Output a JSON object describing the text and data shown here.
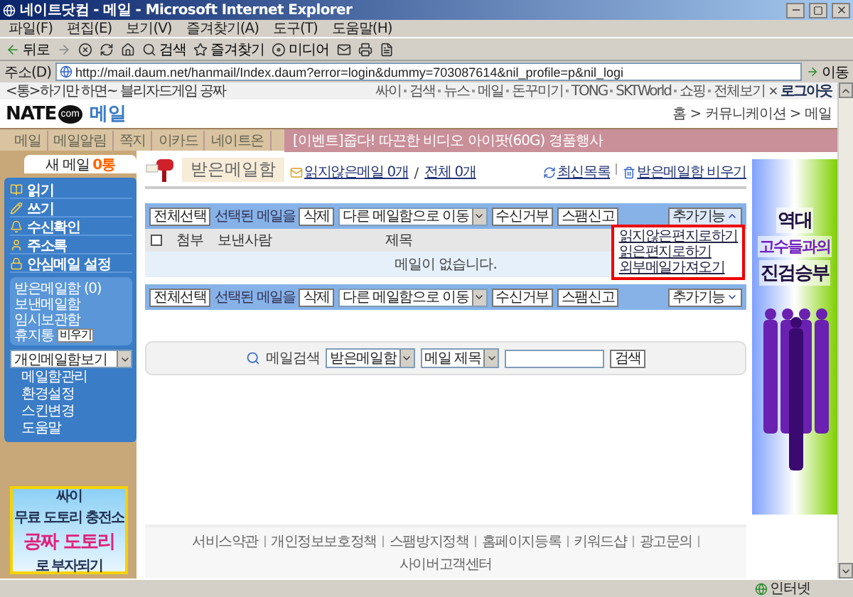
{
  "window": {
    "title": "네이트닷컴 - 메일 - Microsoft Internet Explorer"
  },
  "menu_bar": [
    "파일(F)",
    "편집(E)",
    "보기(V)",
    "즐겨찾기(A)",
    "도구(T)",
    "도움말(H)"
  ],
  "toolbar": {
    "back": "뒤로",
    "search": "검색",
    "favorites": "즐겨찾기",
    "media": "미디어"
  },
  "address_bar": {
    "label": "주소(D)",
    "url": "http://mail.daum.net/hanmail/Index.daum?error=login&dummy=703087614&nil_profile=p&nil_logi",
    "go": "이동"
  },
  "top_strip": {
    "promo": "<통>하기만 하면~ 블리자드게임 공짜",
    "links": [
      "싸이",
      "검색",
      "뉴스",
      "메일",
      "돈꾸미기",
      "TONG",
      "SKTWorld",
      "쇼핑",
      "전체보기"
    ],
    "logout": "로그아웃"
  },
  "header": {
    "logo": "NATE",
    "logo_badge": "com",
    "service": "메일",
    "breadcrumb": "홈 > 커뮤니케이션 > 메일"
  },
  "nav": {
    "tabs": [
      "메일",
      "메일알림",
      "쪽지",
      "이카드",
      "네이트온"
    ],
    "event": "[이벤트]줍다! 따끈한 비디오 아이팟(60G) 경품행사"
  },
  "sidebar": {
    "new_mail_label": "새 메일",
    "new_mail_count": "0통",
    "menu": [
      {
        "kind": "read",
        "label": "읽기"
      },
      {
        "kind": "write",
        "label": "쓰기"
      },
      {
        "kind": "receipt",
        "label": "수신확인"
      },
      {
        "kind": "contacts",
        "label": "주소록"
      },
      {
        "kind": "secure",
        "label": "안심메일 설정"
      }
    ],
    "folders": [
      {
        "label": "받은메일함 (0)"
      },
      {
        "label": "보낸메일함"
      },
      {
        "label": "임시보관함"
      },
      {
        "label": "휴지통",
        "action": "비우기"
      }
    ],
    "folder_select": "개인메일함보기",
    "links": [
      "메일함관리",
      "환경설정",
      "스킨변경",
      "도움말"
    ],
    "ad": [
      "싸이",
      "무료 도토리 충전소",
      "공짜 도토리",
      "로 부자되기"
    ]
  },
  "mailbox": {
    "title": "받은메일함",
    "unread": "읽지않은메일 0개",
    "slash": "/",
    "total": "전체 0개",
    "refresh": "최신목록",
    "empty": "받은메일함 비우기"
  },
  "action_bars": [
    {
      "select_all": "전체선택",
      "selected_label": "선택된 메일을",
      "delete": "삭제",
      "move": "다른 메일함으로 이동",
      "block": "수신거부",
      "spam": "스팸신고",
      "more": "추가기능",
      "expanded": true,
      "more_menu": [
        "읽지않은편지로하기",
        "읽은편지로하기",
        "외부메일가져오기"
      ]
    },
    {
      "select_all": "전체선택",
      "selected_label": "선택된 메일을",
      "delete": "삭제",
      "move": "다른 메일함으로 이동",
      "block": "수신거부",
      "spam": "스팸신고",
      "more": "추가기능",
      "expanded": false
    }
  ],
  "table": {
    "all_checked": false,
    "columns": [
      "첨부",
      "보낸사람",
      "제목"
    ],
    "empty": "메일이 없습니다."
  },
  "search": {
    "label": "메일검색",
    "folder": "받은메일함",
    "field": "메일 제목",
    "button": "검색"
  },
  "footer": [
    "서비스약관",
    "개인정보보호정책",
    "스팸방지정책",
    "홈페이지등록",
    "키워드샵",
    "광고문의",
    "사이버고객센터"
  ],
  "right_ad": [
    "역대",
    "고수들과의",
    "진검승부"
  ],
  "status_bar": {
    "zone": "인터넷"
  }
}
